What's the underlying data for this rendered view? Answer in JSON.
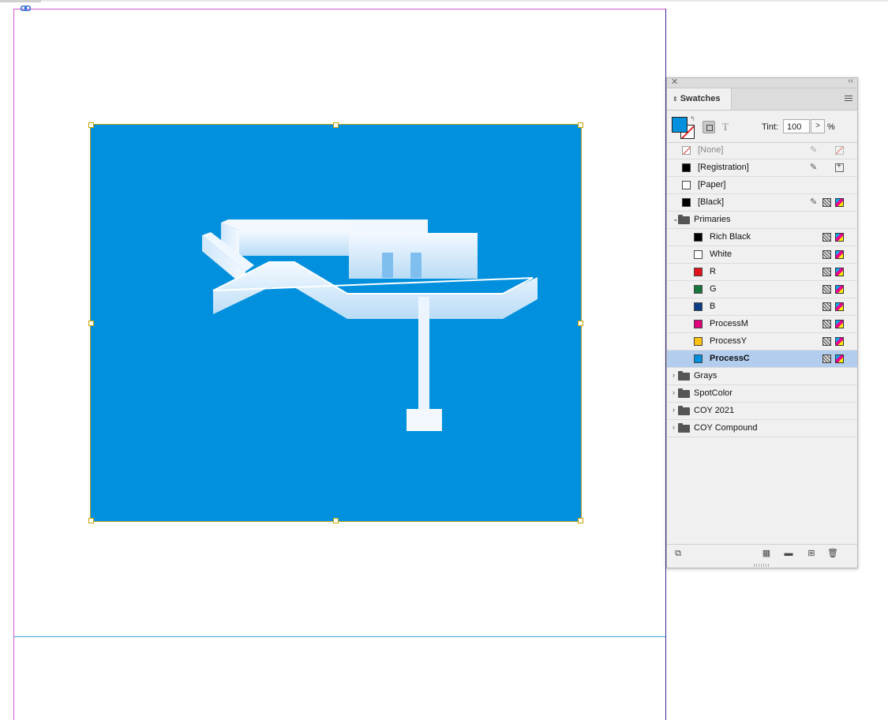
{
  "panel": {
    "title": "Swatches",
    "tab_arrows": "⇕",
    "close_glyph": "✕",
    "collapse_glyph": "‹‹",
    "fill_color": "#0090dd",
    "swap_glyph": "↰",
    "text_button": "T",
    "tint_label": "Tint:",
    "tint_value": "100",
    "tint_stepper": ">",
    "tint_unit": "%"
  },
  "swatches": {
    "none": "[None]",
    "registration": "[Registration]",
    "paper": "[Paper]",
    "black": "[Black]",
    "primaries_group": "Primaries",
    "rich_black": "Rich Black",
    "white": "White",
    "r": "R",
    "g": "G",
    "b": "B",
    "process_m": "ProcessM",
    "process_y": "ProcessY",
    "process_c": "ProcessC",
    "grays_group": "Grays",
    "spot_group": "SpotColor",
    "coy2021_group": "COY 2021",
    "coy_compound_group": "COY Compound"
  },
  "swatch_colors": {
    "registration": "#000000",
    "paper": "#ffffff",
    "black": "#000000",
    "rich_black": "#000000",
    "white": "#ffffff",
    "r": "#e3121b",
    "g": "#17763b",
    "b": "#0d3f86",
    "process_m": "#e3007d",
    "process_y": "#ffc20e",
    "process_c": "#0090dd"
  },
  "footer": {
    "load_icon": "⧉",
    "grid_icon": "▦",
    "folder_icon": "▬",
    "new_icon": "⊞",
    "delete_icon": "🗑"
  },
  "document": {
    "frame_color": "#0090dd"
  }
}
